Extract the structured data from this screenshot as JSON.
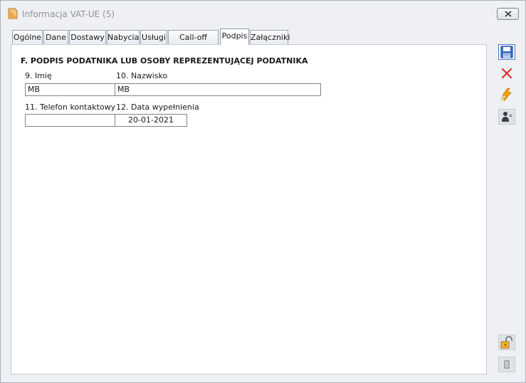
{
  "window": {
    "title": "Informacja VAT-UE (5)"
  },
  "tabs": [
    {
      "label": "Ogólne"
    },
    {
      "label": "Dane"
    },
    {
      "label": "Dostawy"
    },
    {
      "label": "Nabycia"
    },
    {
      "label": "Usługi"
    },
    {
      "label": "Call-off stock"
    },
    {
      "label": "Podpis"
    },
    {
      "label": "Załączniki"
    }
  ],
  "active_tab": "Podpis",
  "section": {
    "title": "F. PODPIS PODATNIKA LUB OSOBY REPREZENTUJĄCEJ PODATNIKA",
    "first_name_label": "9. Imię",
    "first_name_value": "MB",
    "last_name_label": "10. Nazwisko",
    "last_name_value": "MB",
    "phone_label": "11. Telefon kontaktowy",
    "phone_value": "",
    "date_label": "12. Data wypełnienia",
    "date_value": "20-01-2021"
  },
  "toolbar": {
    "icons": [
      "save-icon",
      "cancel-icon",
      "lightning-icon",
      "user-signature-icon",
      "unlock-icon",
      "attach-icon"
    ]
  },
  "colors": {
    "accent": "#4f7fd0",
    "cancel": "#e0302a",
    "lightning": "#f2a400"
  }
}
